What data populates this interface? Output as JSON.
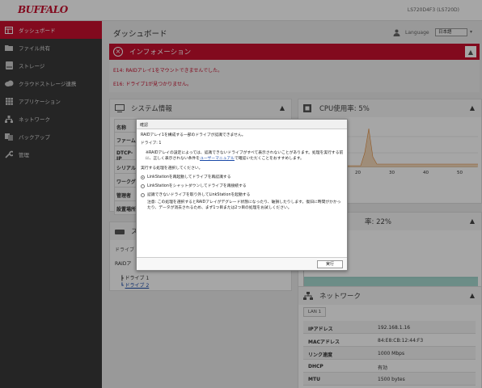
{
  "header": {
    "logo": "BUFFALO",
    "device": "LS720D4F3 (LS720D)"
  },
  "sidebar": {
    "items": [
      {
        "label": "ダッシュボード",
        "icon": "dashboard-icon",
        "active": true
      },
      {
        "label": "ファイル共有",
        "icon": "folder-icon",
        "active": false
      },
      {
        "label": "ストレージ",
        "icon": "storage-icon",
        "active": false
      },
      {
        "label": "クラウドストレージ連携",
        "icon": "cloud-icon",
        "active": false
      },
      {
        "label": "アプリケーション",
        "icon": "apps-icon",
        "active": false
      },
      {
        "label": "ネットワーク",
        "icon": "network-icon",
        "active": false
      },
      {
        "label": "バックアップ",
        "icon": "backup-icon",
        "active": false
      },
      {
        "label": "管理",
        "icon": "wrench-icon",
        "active": false
      }
    ]
  },
  "main": {
    "title": "ダッシュボード",
    "language_label": "Language",
    "language_value": "日本語"
  },
  "info": {
    "title": "インフォメーション",
    "errors": [
      "E14: RAIDアレイ1をマウントできませんでした。",
      "E16: ドライブ1が見つかりません。"
    ]
  },
  "system": {
    "title": "システム情報",
    "rows": [
      "名称",
      "ファーム",
      "DTCP-IP",
      "シリアル",
      "ワークグ",
      "管理者",
      "設置場所"
    ]
  },
  "storage": {
    "title_partial": "ス",
    "tab": "ドライブ",
    "raid_label": "RAIDア",
    "tree": [
      "ドライブ 1",
      "ドライブ 2"
    ]
  },
  "cpu": {
    "title": "CPU使用率: 5%",
    "x_ticks": [
      "20",
      "30",
      "40",
      "50"
    ],
    "x_ticks_mem": [
      "30",
      "40",
      "50"
    ]
  },
  "memory": {
    "title_partial": "率: 22%"
  },
  "network": {
    "title": "ネットワーク",
    "tab": "LAN 1",
    "rows": [
      {
        "k": "IPアドレス",
        "v": "192.168.1.16"
      },
      {
        "k": "MACアドレス",
        "v": "84:E8:CB:12:44:F3"
      },
      {
        "k": "リンク速度",
        "v": "1000 Mbps"
      },
      {
        "k": "DHCP",
        "v": "有効"
      },
      {
        "k": "MTU",
        "v": "1500 bytes"
      }
    ]
  },
  "dialog": {
    "title": "確認",
    "line1": "RAIDアレイ1を構成する一部のドライブが認識できません。",
    "line2": "ドライブ: 1",
    "note_a": "※RAIDアレイの設定によっては、認識できないドライブがすべて表示されないことがあります。処理を実行する前に、正しく表示されない条件を",
    "note_link": "ユーザーマニュアル",
    "note_b": "で確認いただくことをおすすめします。",
    "prompt": "実行する処理を選択してください。",
    "options": [
      "LinkStationを再起動してドライブを再認識する",
      "LinkStationをシャットダウンしてドライブを再接続する",
      "認識できないドライブを取り外してLinkStationを起動する"
    ],
    "warning": "注意: この処理を選択するとRAIDアレイがデグレード状態になったり、破損したりします。復旧に時間がかかったり、データが消去されるため、まず1つ目または2つ目の処理をお試しください。",
    "run": "実行"
  }
}
